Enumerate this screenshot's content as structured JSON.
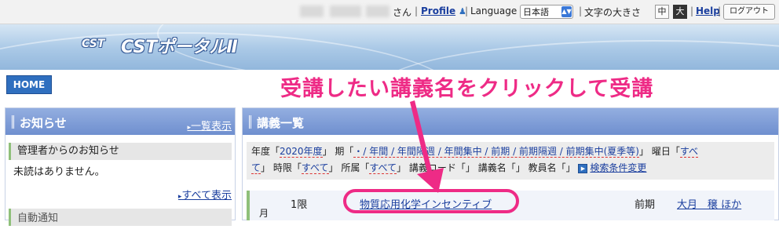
{
  "topbar": {
    "san": "さん",
    "sep": "|",
    "profile_label": "Profile",
    "language_label": "Language",
    "language_value": "日本語",
    "text_size_label": "文字の大きさ",
    "size_medium": "中",
    "size_large": "大",
    "help_label": "Help",
    "logout_label": "ログアウト"
  },
  "banner": {
    "logo_cst": "CST",
    "portal_title": "CSTポータルⅡ"
  },
  "nav": {
    "home_label": "HOME"
  },
  "annotation": {
    "text": "受講したい講義名をクリックして受講"
  },
  "notice_panel": {
    "title": "お知らせ",
    "list_link": "一覧表示",
    "admin_header": "管理者からのお知らせ",
    "no_unread": "未読はありません。",
    "show_all": "すべて表示",
    "auto_notice": "自動通知"
  },
  "course_panel": {
    "title": "講義一覧",
    "conditions": {
      "year_label": "年度「",
      "year_value": "2020年度",
      "year_close": "」",
      "period_label": " 期「",
      "period_value": "・/ 年間 / 年間隔週 / 年間集中 / 前期 / 前期隔週 / 前期集中(夏季等)",
      "period_close": "」",
      "day_label": " 曜日「",
      "day_value_a": "すべ",
      "day_value_b": "て",
      "day_close": "」",
      "hour_label": " 時限「",
      "hour_value": "すべて",
      "hour_close": "」",
      "affil_label": " 所属「",
      "affil_value": "すべて",
      "affil_close": "」",
      "code_label": " 講義コード「」",
      "name_label": " 講義名「」",
      "teacher_label": " 教員名「」",
      "change_link": "検索条件変更"
    },
    "row": {
      "day_label": "月",
      "period": "1限",
      "course_name": "物質応用化学インセンティブ",
      "term": "前期",
      "teacher": "大月　穣 ほか"
    }
  },
  "colors": {
    "accent_pink": "#ee2b86",
    "header_blue": "#6f8fcf",
    "home_blue": "#2f6fbf"
  }
}
